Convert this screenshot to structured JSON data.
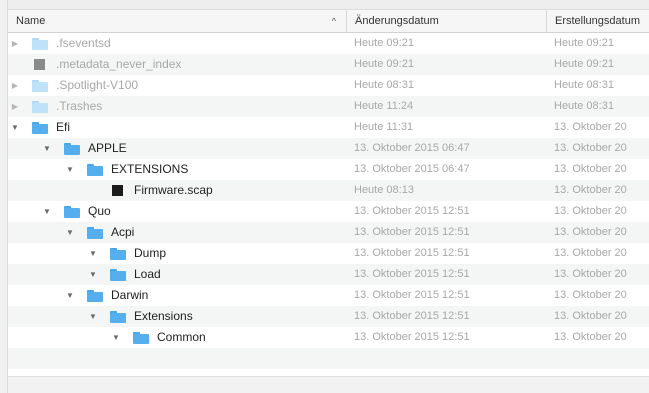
{
  "columns": {
    "name": "Name",
    "modified": "Änderungsdatum",
    "created": "Erstellungsdatum"
  },
  "sort_indicator": "^",
  "disclosure": {
    "collapsed": "▶",
    "expanded": "▼"
  },
  "rows": [
    {
      "name": ".fseventsd",
      "modified": "Heute 09:21",
      "created": "Heute 09:21"
    },
    {
      "name": ".metadata_never_index",
      "modified": "Heute 09:21",
      "created": "Heute 09:21"
    },
    {
      "name": ".Spotlight-V100",
      "modified": "Heute 08:31",
      "created": "Heute 08:31"
    },
    {
      "name": ".Trashes",
      "modified": "Heute 11:24",
      "created": "Heute 08:31"
    },
    {
      "name": "Efi",
      "modified": "Heute 11:31",
      "created": "13. Oktober 20"
    },
    {
      "name": "APPLE",
      "modified": "13. Oktober 2015 06:47",
      "created": "13. Oktober 20"
    },
    {
      "name": "EXTENSIONS",
      "modified": "13. Oktober 2015 06:47",
      "created": "13. Oktober 20"
    },
    {
      "name": "Firmware.scap",
      "modified": "Heute 08:13",
      "created": "13. Oktober 20"
    },
    {
      "name": "Quo",
      "modified": "13. Oktober 2015 12:51",
      "created": "13. Oktober 20"
    },
    {
      "name": "Acpi",
      "modified": "13. Oktober 2015 12:51",
      "created": "13. Oktober 20"
    },
    {
      "name": "Dump",
      "modified": "13. Oktober 2015 12:51",
      "created": "13. Oktober 20"
    },
    {
      "name": "Load",
      "modified": "13. Oktober 2015 12:51",
      "created": "13. Oktober 20"
    },
    {
      "name": "Darwin",
      "modified": "13. Oktober 2015 12:51",
      "created": "13. Oktober 20"
    },
    {
      "name": "Extensions",
      "modified": "13. Oktober 2015 12:51",
      "created": "13. Oktober 20"
    },
    {
      "name": "Common",
      "modified": "13. Oktober 2015 12:51",
      "created": "13. Oktober 20"
    }
  ],
  "colors": {
    "folder": "#55aeee",
    "folder_hidden": "#bfe2f9",
    "dimmed_text": "#a8a8a8",
    "alt_row": "#f4f5f5"
  }
}
